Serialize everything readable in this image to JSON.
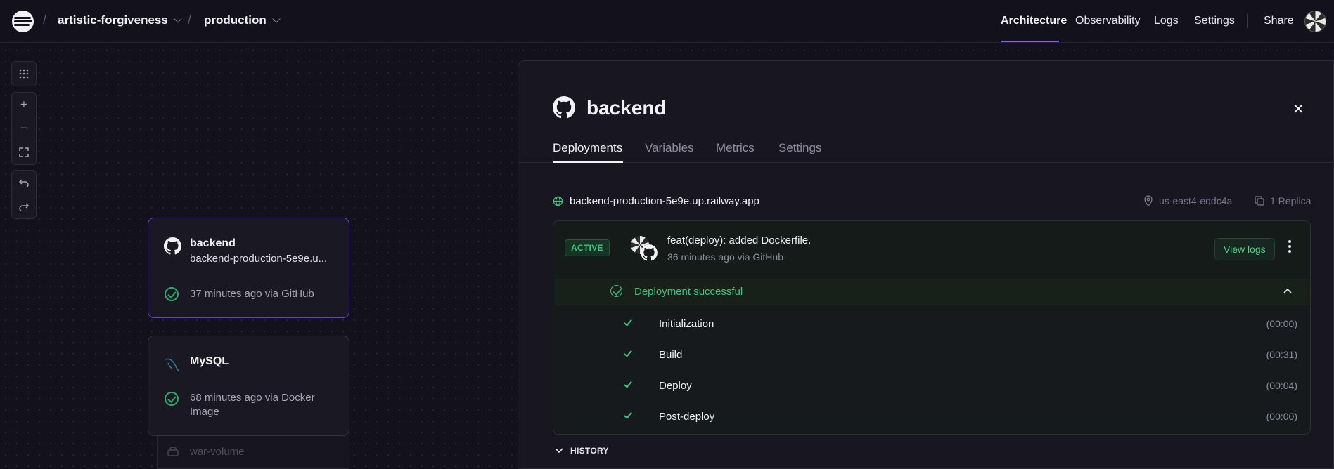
{
  "header": {
    "project": "artistic-forgiveness",
    "environment": "production",
    "separator": "/",
    "nav": [
      "Architecture",
      "Observability",
      "Logs",
      "Settings",
      "Share"
    ],
    "active_nav": "Architecture"
  },
  "canvas_tools": {
    "grid_icon": "grid-icon",
    "zoom_in": "+",
    "zoom_out": "−",
    "undo_icon": "undo-icon",
    "redo_icon": "redo-icon"
  },
  "services": [
    {
      "name": "backend",
      "subtitle": "backend-production-5e9e.u...",
      "status": "37 minutes ago via GitHub",
      "icon": "github-icon",
      "selected": true
    },
    {
      "name": "MySQL",
      "status_line1": "68 minutes ago via Docker",
      "status_line2": "Image",
      "icon": "mysql-icon",
      "volume": "war-volume"
    }
  ],
  "panel": {
    "title": "backend",
    "tabs": [
      "Deployments",
      "Variables",
      "Metrics",
      "Settings"
    ],
    "active_tab": "Deployments",
    "domain": "backend-production-5e9e.up.railway.app",
    "region": "us-east4-eqdc4a",
    "replicas": "1 Replica",
    "deployment": {
      "badge": "ACTIVE",
      "commit_message": "feat(deploy): added Dockerfile.",
      "commit_meta": "36 minutes ago via GitHub",
      "view_logs": "View logs",
      "status": "Deployment successful",
      "steps": [
        {
          "name": "Initialization",
          "time": "(00:00)"
        },
        {
          "name": "Build",
          "time": "(00:31)"
        },
        {
          "name": "Deploy",
          "time": "(00:04)"
        },
        {
          "name": "Post-deploy",
          "time": "(00:00)"
        }
      ]
    },
    "history_label": "HISTORY"
  },
  "colors": {
    "accent": "#8b5cf6",
    "success": "#3fc47d",
    "background": "#13111c"
  }
}
